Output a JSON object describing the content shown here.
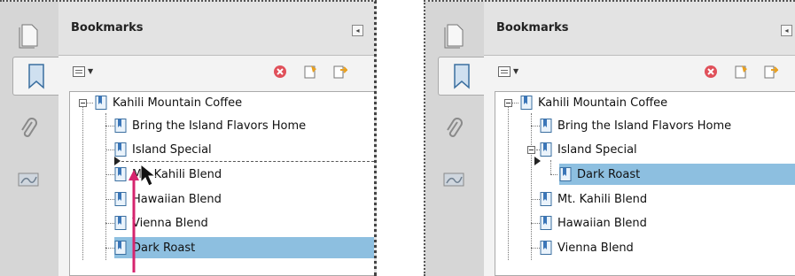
{
  "colors": {
    "panel": "#e3e3e3",
    "selection": "#8dbfe0",
    "arrow": "#d6246e"
  },
  "icons": {
    "page": "pages-icon",
    "bookmark": "bookmark-icon",
    "attach": "paperclip-icon",
    "sign": "signature-icon",
    "delete": "delete-bookmark-icon",
    "new": "new-bookmark-icon",
    "newfrom": "new-bookmark-from-structure-icon"
  },
  "left": {
    "title": "Bookmarks",
    "items": [
      {
        "label": "Kahili Mountain Coffee"
      },
      {
        "label": "Bring the Island Flavors Home"
      },
      {
        "label": "Island Special"
      },
      {
        "label": "Mt. Kahili Blend"
      },
      {
        "label": "Hawaiian Blend"
      },
      {
        "label": "Vienna Blend"
      },
      {
        "label": "Dark Roast",
        "selected": true
      }
    ]
  },
  "right": {
    "title": "Bookmarks",
    "items": [
      {
        "label": "Kahili Mountain Coffee"
      },
      {
        "label": "Bring the Island Flavors Home"
      },
      {
        "label": "Island Special"
      },
      {
        "label": "Dark Roast",
        "selected": true
      },
      {
        "label": "Mt. Kahili Blend"
      },
      {
        "label": "Hawaiian Blend"
      },
      {
        "label": "Vienna Blend"
      }
    ]
  }
}
